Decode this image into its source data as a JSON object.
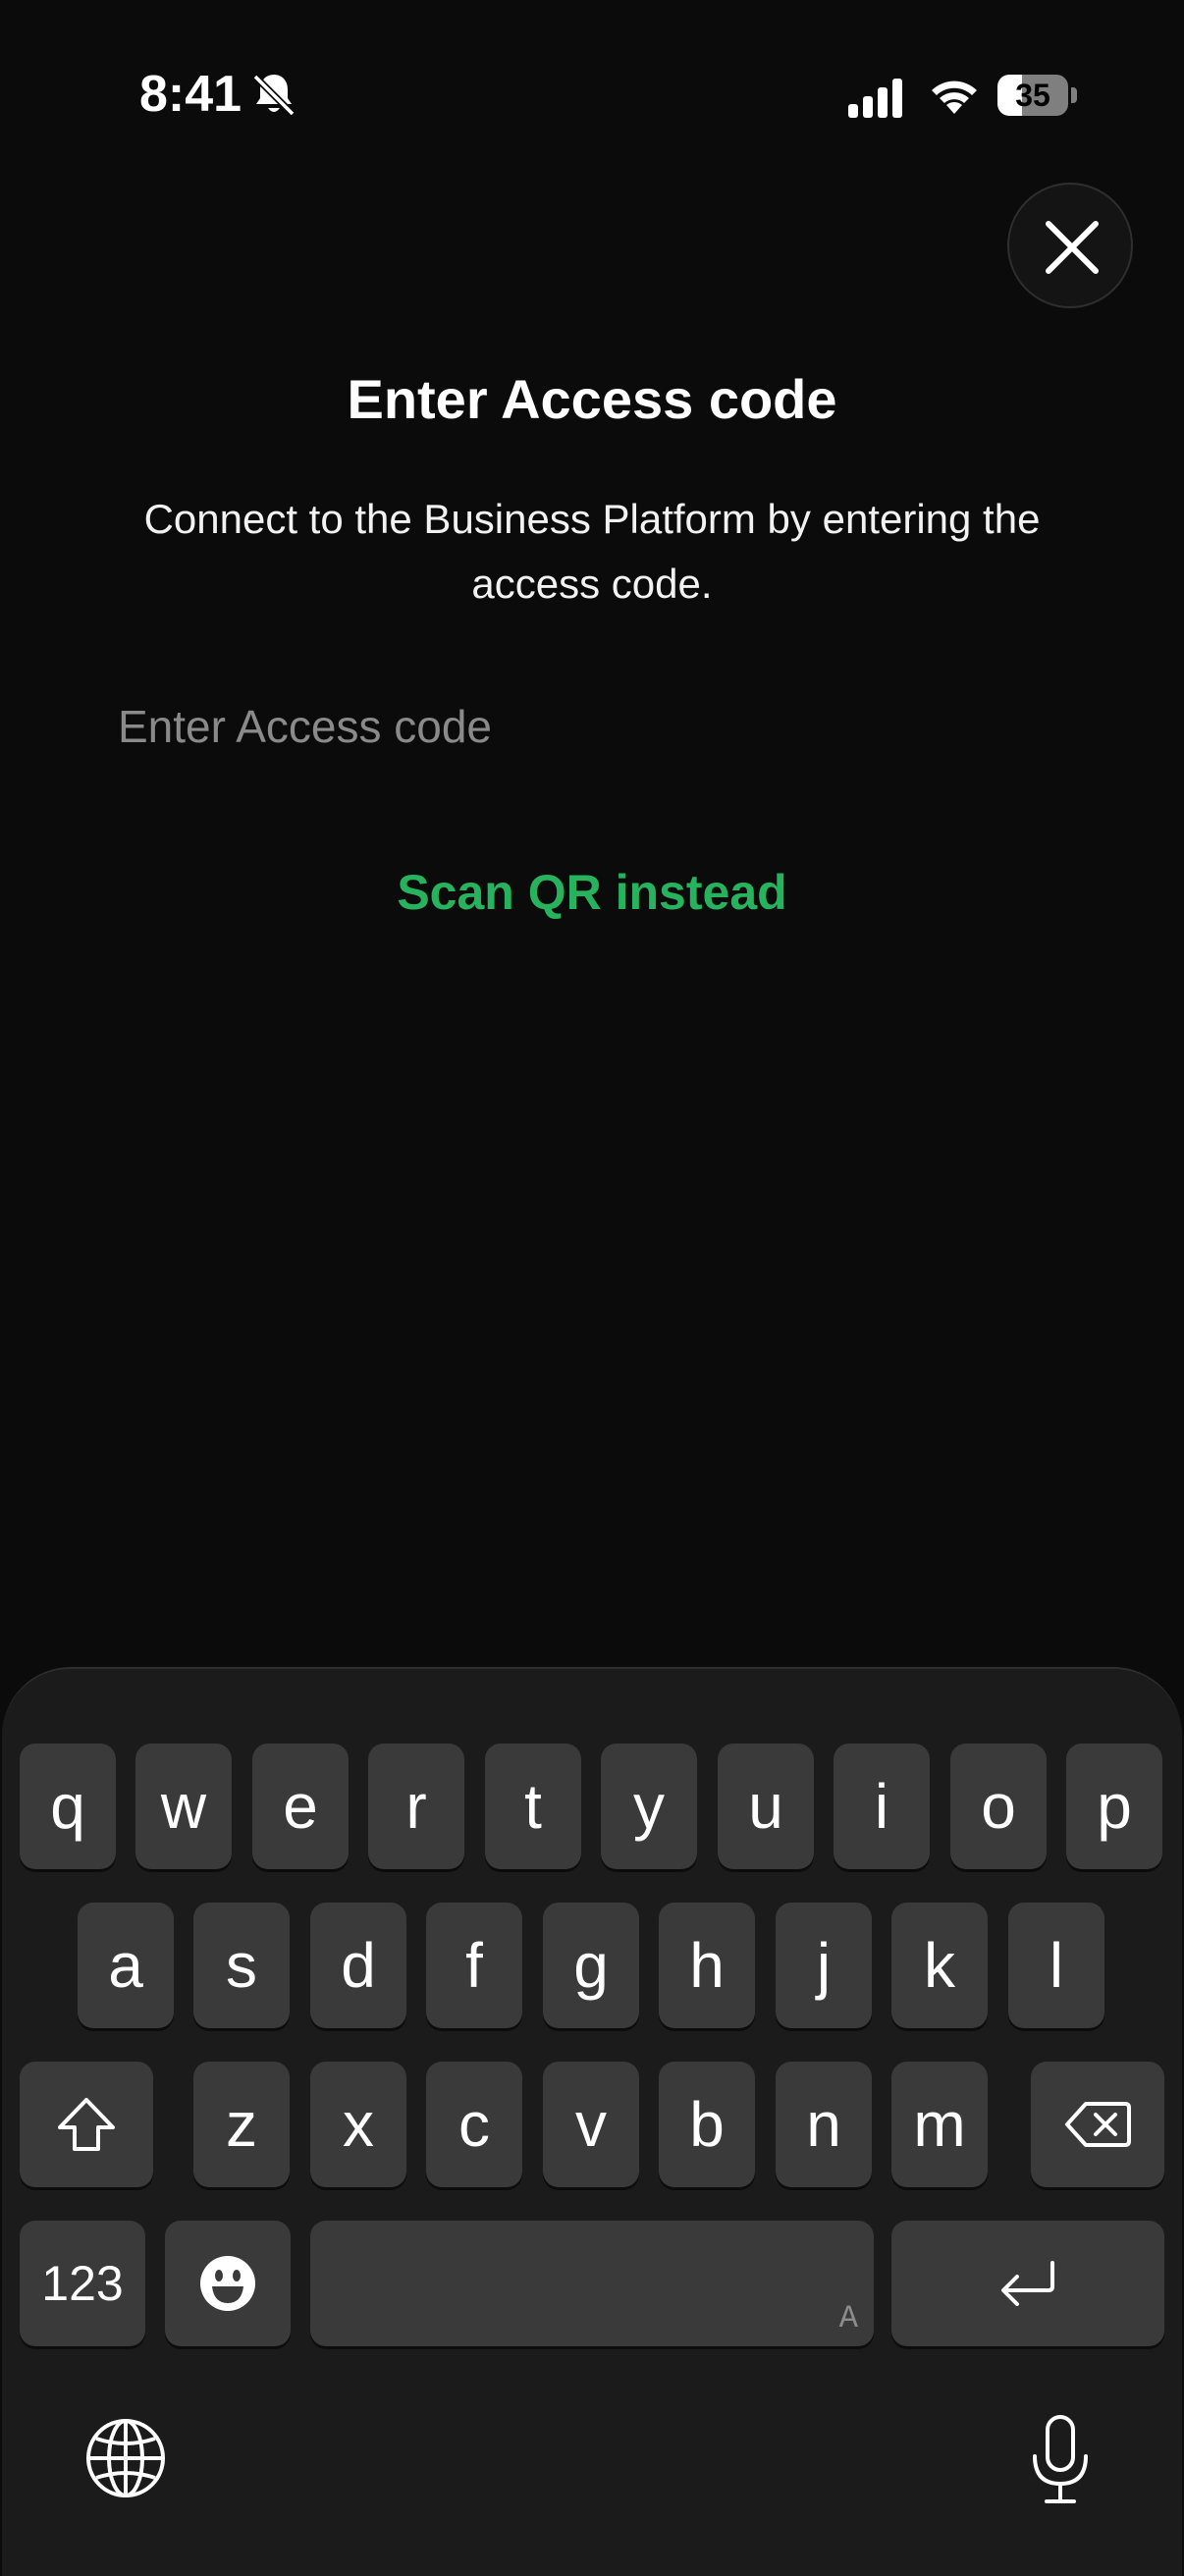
{
  "status_bar": {
    "time": "8:41",
    "battery_level": "35",
    "battery_fraction": 0.35
  },
  "icons": {
    "close": "close-icon",
    "bell": "bell-slash-icon",
    "globe": "globe-icon",
    "mic": "microphone-icon",
    "shift": "shift-icon",
    "delete": "backspace-icon",
    "emoji": "emoji-icon",
    "return": "return-icon"
  },
  "page": {
    "title": "Enter Access code",
    "subtitle": "Connect to the Business Platform by entering the access code.",
    "input_placeholder": "Enter Access code",
    "input_value": "",
    "scan_link": "Scan QR instead"
  },
  "colors": {
    "background": "#0b0b0c",
    "accent": "#27b35e",
    "keyboard_bg": "#1b1b1b",
    "key_bg": "#3a3a3a"
  },
  "keyboard": {
    "row1": [
      "q",
      "w",
      "e",
      "r",
      "t",
      "y",
      "u",
      "i",
      "o",
      "p"
    ],
    "row2": [
      "a",
      "s",
      "d",
      "f",
      "g",
      "h",
      "j",
      "k",
      "l"
    ],
    "row3": [
      "z",
      "x",
      "c",
      "v",
      "b",
      "n",
      "m"
    ],
    "numbers_label": "123",
    "space_indicator": "A"
  }
}
